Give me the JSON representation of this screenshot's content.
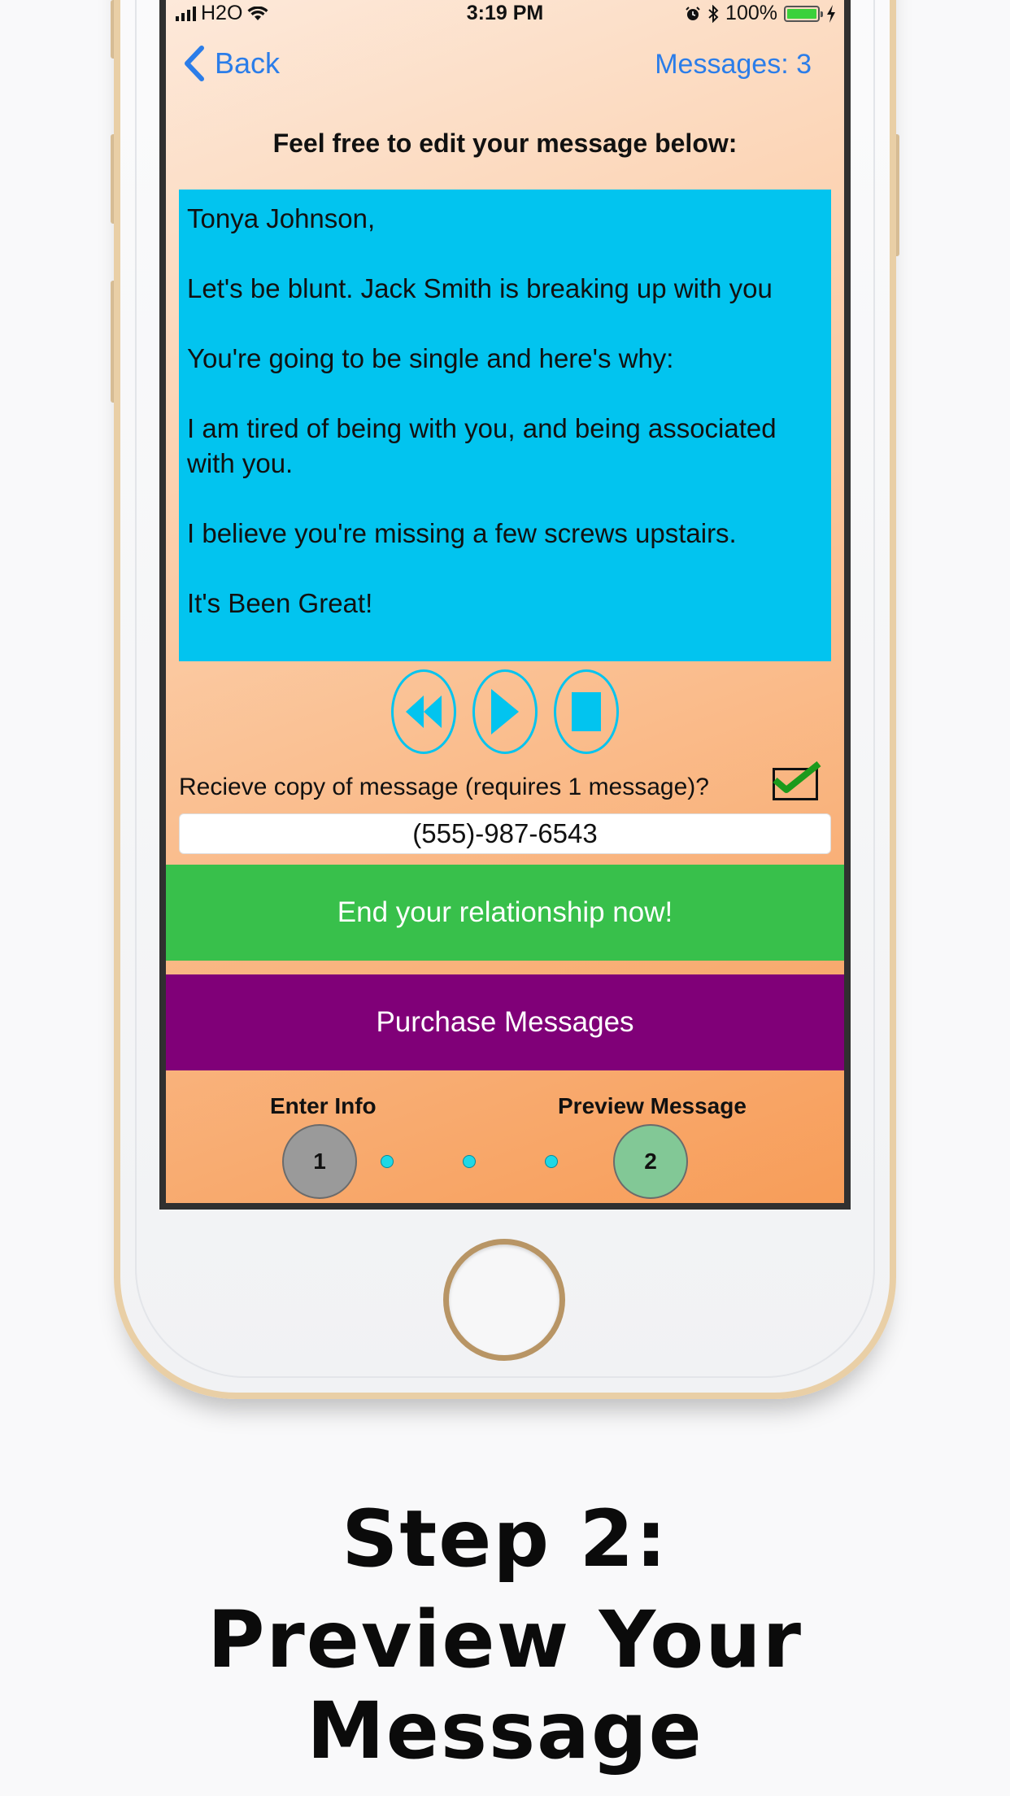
{
  "status_bar": {
    "carrier": "H2O",
    "time": "3:19 PM",
    "battery_percent": "100%"
  },
  "nav": {
    "back_label": "Back",
    "messages_count": "Messages: 3"
  },
  "instruction": "Feel free to edit your message below:",
  "message_lines": [
    "Tonya Johnson,",
    "Let's be blunt. Jack Smith is breaking up with you",
    "You're going to be single and here's why:",
    "I am tired of being with you, and being associated with you.",
    "I believe you're missing a few screws upstairs.",
    "It's Been Great!"
  ],
  "copy_option": {
    "label": "Recieve copy of message (requires 1 message)?",
    "checked": true
  },
  "phone_number": "(555)-987-6543",
  "buttons": {
    "end_relationship": "End your relationship now!",
    "purchase": "Purchase Messages"
  },
  "steps": {
    "step1_label": "Enter Info",
    "step1_number": "1",
    "step2_label": "Preview Message",
    "step2_number": "2"
  },
  "caption": {
    "line1": "Step 2:",
    "line2": "Preview Your Message"
  },
  "colors": {
    "message_bg": "#02c4ef",
    "end_button": "#38c04b",
    "purchase_button": "#800078",
    "link": "#2b7de9",
    "step_inactive": "#9a9a9a",
    "step_active": "#82c896"
  },
  "icons": [
    "signal-icon",
    "wifi-icon",
    "alarm-icon",
    "bluetooth-icon",
    "battery-icon",
    "charging-icon",
    "back-chevron-icon",
    "rewind-icon",
    "play-icon",
    "stop-icon",
    "checkmark-icon"
  ]
}
